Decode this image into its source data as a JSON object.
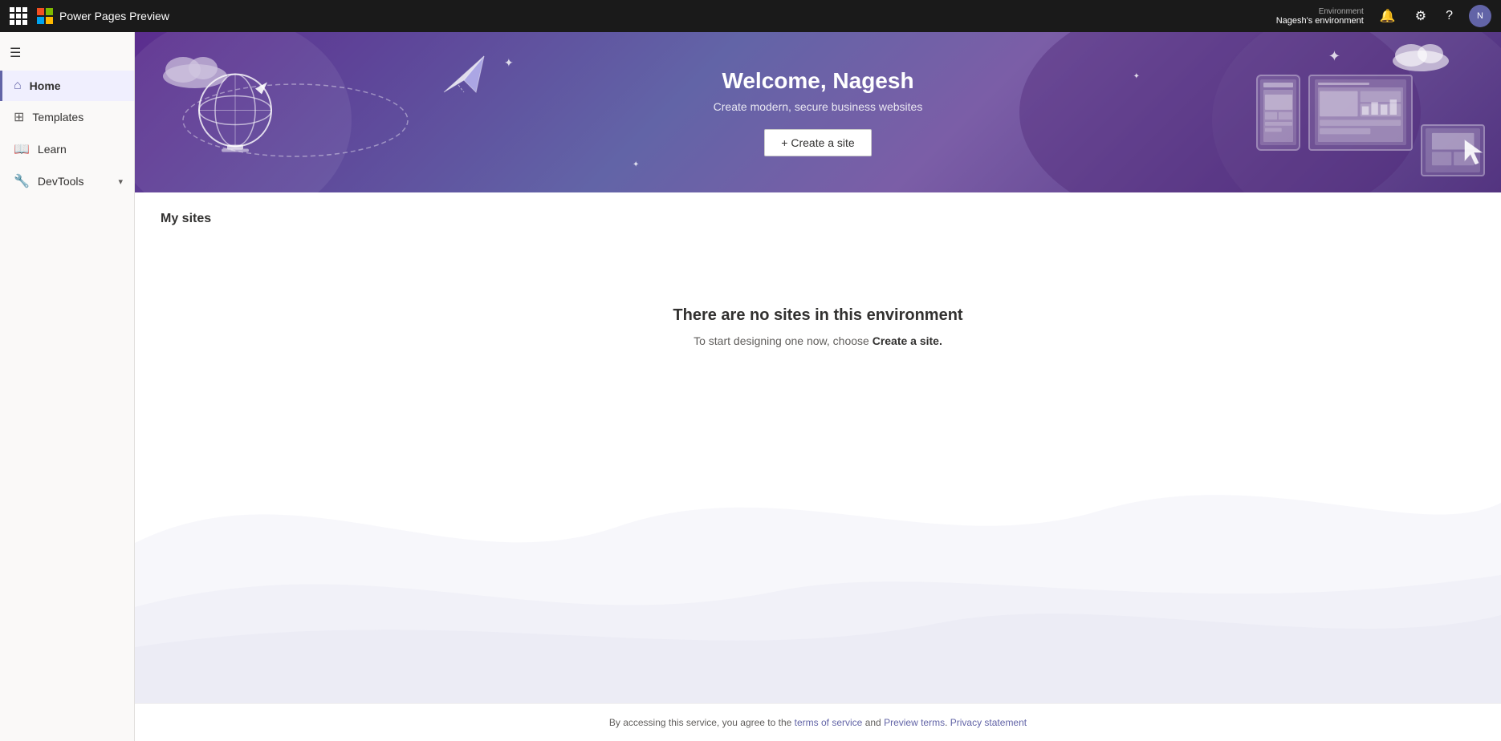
{
  "topnav": {
    "title": "Power Pages Preview",
    "env_label": "Environment",
    "env_name": "Nagesh's environment",
    "waffle_tooltip": "Apps",
    "notification_icon": "🔔",
    "settings_icon": "⚙",
    "help_icon": "?",
    "avatar_initials": "N"
  },
  "sidebar": {
    "hamburger_label": "☰",
    "items": [
      {
        "id": "home",
        "label": "Home",
        "icon": "home",
        "active": true
      },
      {
        "id": "templates",
        "label": "Templates",
        "icon": "grid",
        "active": false
      },
      {
        "id": "learn",
        "label": "Learn",
        "icon": "book",
        "active": false
      },
      {
        "id": "devtools",
        "label": "DevTools",
        "icon": "tools",
        "active": false,
        "has_chevron": true
      }
    ]
  },
  "banner": {
    "welcome_text": "Welcome, Nagesh",
    "subtitle": "Create modern, secure business websites",
    "create_btn_label": "+ Create a site"
  },
  "my_sites": {
    "section_title": "My sites",
    "empty_title": "There are no sites in this environment",
    "empty_desc_prefix": "To start designing one now, choose ",
    "empty_desc_link": "Create a site.",
    "empty_desc_suffix": ""
  },
  "footer": {
    "text_prefix": "By accessing this service, you agree to the ",
    "tos_link": "terms of service",
    "text_middle": " and ",
    "preview_link": "Preview terms",
    "text_end": ". ",
    "privacy_link": "Privacy statement"
  }
}
